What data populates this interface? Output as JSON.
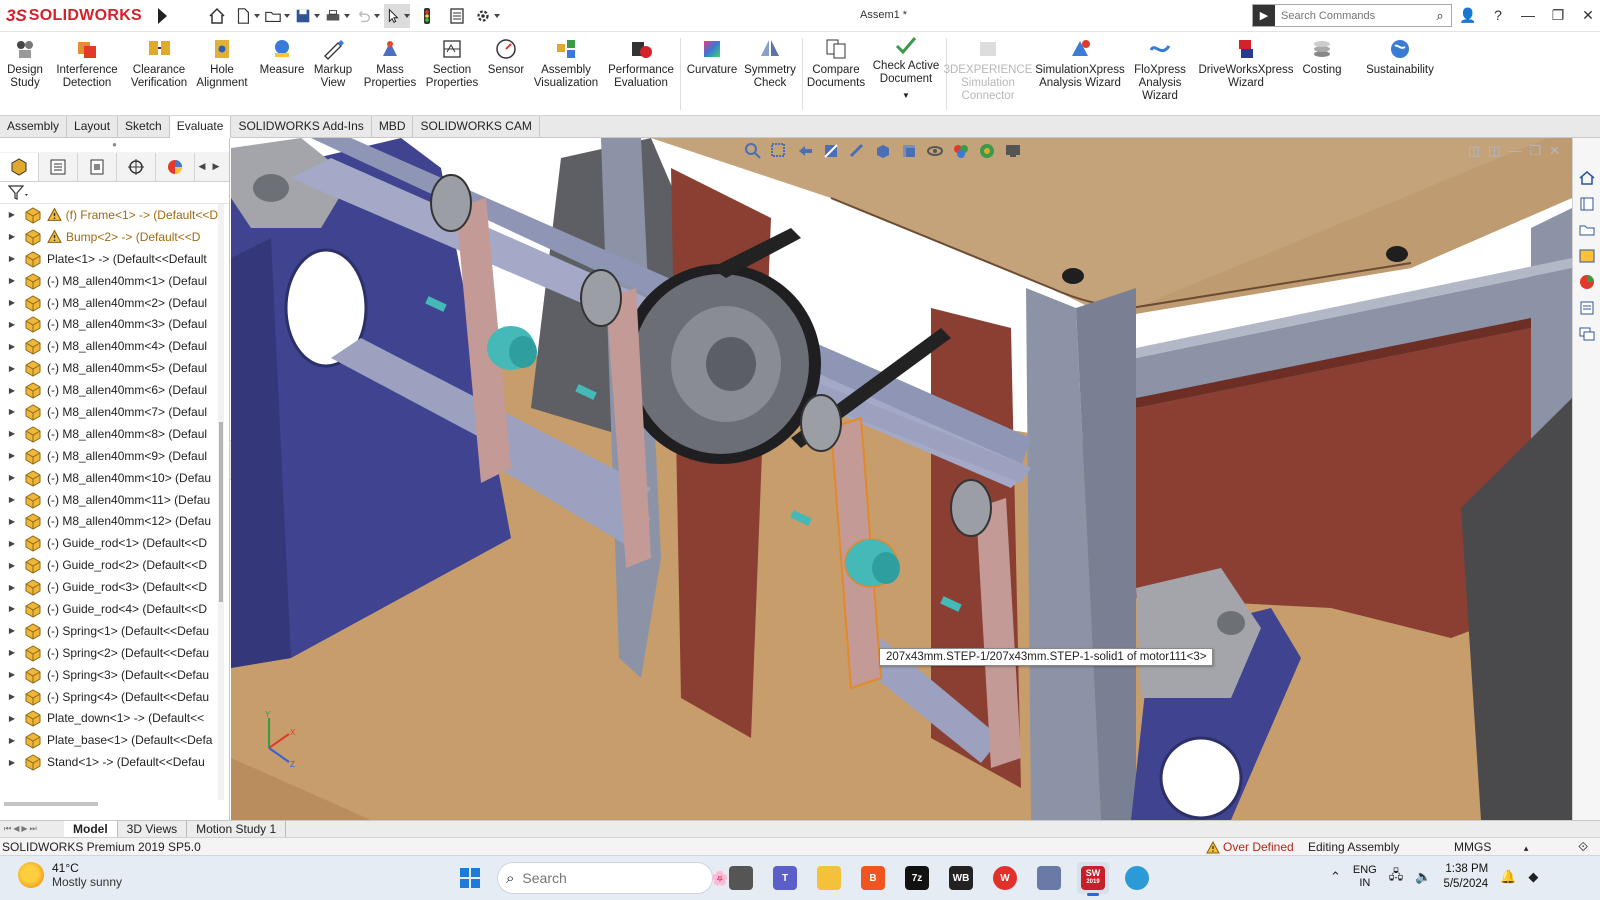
{
  "app": {
    "logo_ds": "3S",
    "logo_text": "SOLIDWORKS",
    "doc_title": "Assem1 *",
    "search_placeholder": "Search Commands"
  },
  "ribbon": {
    "design_study": [
      "Design",
      "Study"
    ],
    "interference": [
      "Interference",
      "Detection"
    ],
    "clearance": [
      "Clearance",
      "Verification"
    ],
    "hole_alignment": [
      "Hole",
      "Alignment"
    ],
    "measure": [
      "Measure"
    ],
    "markup": [
      "Markup",
      "View"
    ],
    "mass": [
      "Mass",
      "Properties"
    ],
    "section": [
      "Section",
      "Properties"
    ],
    "sensor": [
      "Sensor"
    ],
    "assembly_vis": [
      "Assembly",
      "Visualization"
    ],
    "performance": [
      "Performance",
      "Evaluation"
    ],
    "curvature": [
      "Curvature"
    ],
    "symmetry": [
      "Symmetry",
      "Check"
    ],
    "compare": [
      "Compare",
      "Documents"
    ],
    "check_active": [
      "Check Active",
      "Document"
    ],
    "experience": [
      "3DEXPERIENCE",
      "Simulation",
      "Connector"
    ],
    "simxpress": [
      "SimulationXpress",
      "Analysis Wizard"
    ],
    "floxpress": [
      "FloXpress",
      "Analysis",
      "Wizard"
    ],
    "driveworks": [
      "DriveWorksXpress",
      "Wizard"
    ],
    "costing": [
      "Costing"
    ],
    "sustainability": [
      "Sustainability"
    ]
  },
  "tabs": [
    "Assembly",
    "Layout",
    "Sketch",
    "Evaluate",
    "SOLIDWORKS Add-Ins",
    "MBD",
    "SOLIDWORKS CAM"
  ],
  "active_tab": "Evaluate",
  "tree": [
    {
      "label": "(f) Frame<1> -> (Default<<D",
      "warn": true
    },
    {
      "label": "Bump<2> -> (Default<<D",
      "warn": true
    },
    {
      "label": "Plate<1> -> (Default<<Default",
      "warn": false
    },
    {
      "label": "(-) M8_allen40mm<1> (Defaul",
      "warn": false
    },
    {
      "label": "(-) M8_allen40mm<2> (Defaul",
      "warn": false
    },
    {
      "label": "(-) M8_allen40mm<3> (Defaul",
      "warn": false
    },
    {
      "label": "(-) M8_allen40mm<4> (Defaul",
      "warn": false
    },
    {
      "label": "(-) M8_allen40mm<5> (Defaul",
      "warn": false
    },
    {
      "label": "(-) M8_allen40mm<6> (Defaul",
      "warn": false
    },
    {
      "label": "(-) M8_allen40mm<7> (Defaul",
      "warn": false
    },
    {
      "label": "(-) M8_allen40mm<8> (Defaul",
      "warn": false
    },
    {
      "label": "(-) M8_allen40mm<9> (Defaul",
      "warn": false
    },
    {
      "label": "(-) M8_allen40mm<10> (Defau",
      "warn": false
    },
    {
      "label": "(-) M8_allen40mm<11> (Defau",
      "warn": false
    },
    {
      "label": "(-) M8_allen40mm<12> (Defau",
      "warn": false
    },
    {
      "label": "(-) Guide_rod<1> (Default<<D",
      "warn": false
    },
    {
      "label": "(-) Guide_rod<2> (Default<<D",
      "warn": false
    },
    {
      "label": "(-) Guide_rod<3> (Default<<D",
      "warn": false
    },
    {
      "label": "(-) Guide_rod<4> (Default<<D",
      "warn": false
    },
    {
      "label": "(-) Spring<1> (Default<<Defau",
      "warn": false
    },
    {
      "label": "(-) Spring<2> (Default<<Defau",
      "warn": false
    },
    {
      "label": "(-) Spring<3> (Default<<Defau",
      "warn": false
    },
    {
      "label": "(-) Spring<4> (Default<<Defau",
      "warn": false
    },
    {
      "label": "Plate_down<1> -> (Default<<",
      "warn": false
    },
    {
      "label": "Plate_base<1> (Default<<Defa",
      "warn": false
    },
    {
      "label": "Stand<1> -> (Default<<Defau",
      "warn": false
    }
  ],
  "viewport": {
    "tooltip": "207x43mm.STEP-1/207x43mm.STEP-1-solid1 of motor111<3>"
  },
  "bottom_tabs": [
    "Model",
    "3D Views",
    "Motion Study 1"
  ],
  "active_bottom_tab": "Model",
  "status": {
    "product": "SOLIDWORKS Premium 2019 SP5.0",
    "over_defined": "Over Defined",
    "editing": "Editing Assembly",
    "units": "MMGS"
  },
  "taskbar": {
    "temp": "41°C",
    "weather": "Mostly sunny",
    "search_placeholder": "Search",
    "lang_1": "ENG",
    "lang_2": "IN",
    "time": "1:38 PM",
    "date": "5/5/2024",
    "app_labels": {
      "sevenzip": "7z",
      "wb": "WB",
      "sw": "SW",
      "sw_year": "2019"
    }
  },
  "colors": {
    "accent_red": "#d3222a",
    "plate_tan": "#c9a06e",
    "frame_gray": "#8d93a6",
    "panel_navy": "#3f4390",
    "bracket_pink": "#c49a96",
    "wall_brown": "#8a3f32",
    "motor_teal": "#45b9b8"
  }
}
